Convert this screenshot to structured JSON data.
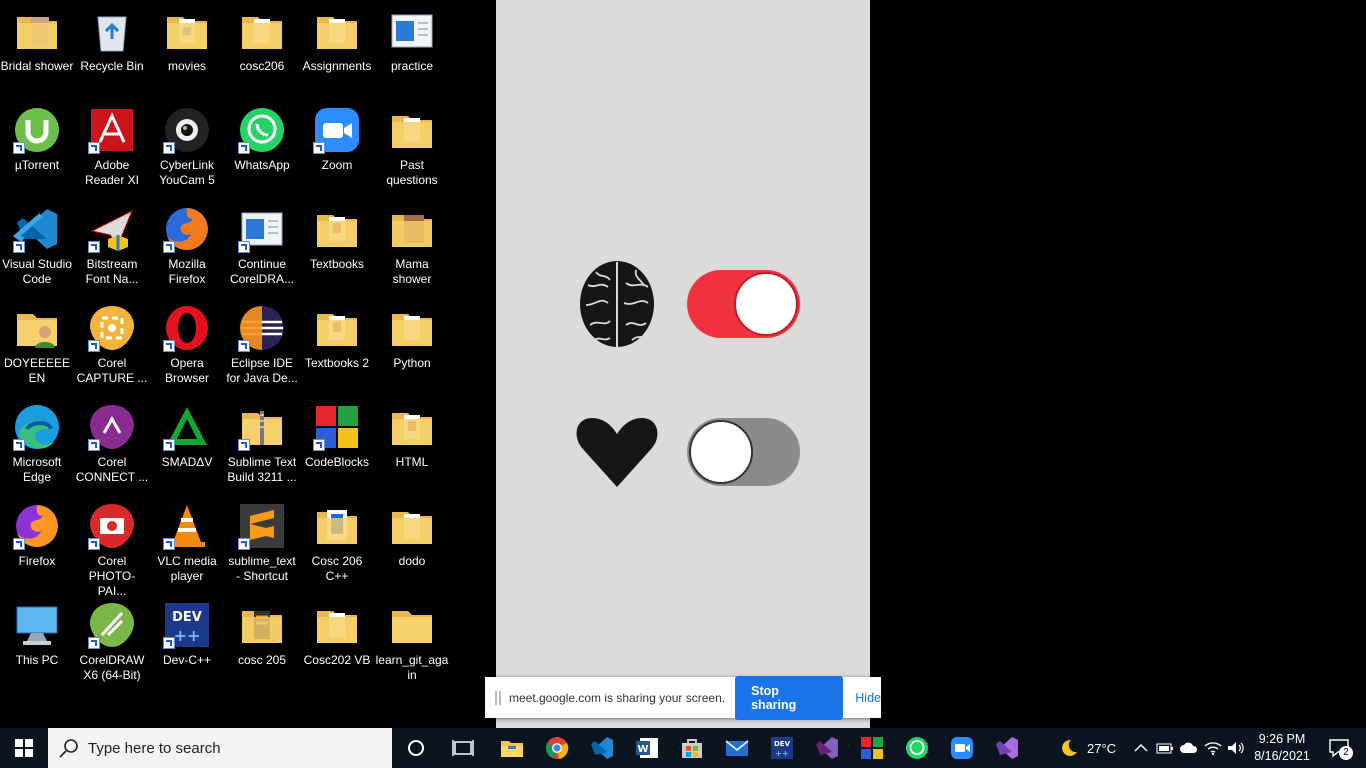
{
  "desktop": {
    "icons": [
      {
        "label": "Bridal shower"
      },
      {
        "label": "Recycle Bin"
      },
      {
        "label": "movies"
      },
      {
        "label": "cosc206"
      },
      {
        "label": "Assignments"
      },
      {
        "label": "practice"
      },
      {
        "label": "µTorrent"
      },
      {
        "label": "Adobe Reader XI"
      },
      {
        "label": "CyberLink YouCam 5"
      },
      {
        "label": "WhatsApp"
      },
      {
        "label": "Zoom"
      },
      {
        "label": "Past questions"
      },
      {
        "label": "Visual Studio Code"
      },
      {
        "label": "Bitstream Font Na..."
      },
      {
        "label": "Mozilla Firefox"
      },
      {
        "label": "Continue CorelDRA..."
      },
      {
        "label": "Textbooks"
      },
      {
        "label": "Mama shower"
      },
      {
        "label": "DOYEEEEEEN"
      },
      {
        "label": "Corel CAPTURE ..."
      },
      {
        "label": "Opera Browser"
      },
      {
        "label": "Eclipse IDE for Java De..."
      },
      {
        "label": "Textbooks 2"
      },
      {
        "label": "Python"
      },
      {
        "label": "Microsoft Edge"
      },
      {
        "label": "Corel CONNECT ..."
      },
      {
        "label": "SMADΔV"
      },
      {
        "label": "Sublime Text Build 3211 ..."
      },
      {
        "label": "CodeBlocks"
      },
      {
        "label": "HTML"
      },
      {
        "label": "Firefox"
      },
      {
        "label": "Corel PHOTO-PAI..."
      },
      {
        "label": "VLC media player"
      },
      {
        "label": "sublime_text - Shortcut"
      },
      {
        "label": "Cosc 206 C++"
      },
      {
        "label": "dodo"
      },
      {
        "label": "This PC"
      },
      {
        "label": "CorelDRAW X6 (64-Bit)"
      },
      {
        "label": "Dev-C++"
      },
      {
        "label": "cosc 205"
      },
      {
        "label": "Cosc202 VB"
      },
      {
        "label": "learn_git_again"
      }
    ]
  },
  "share_bar": {
    "message": "meet.google.com is sharing your screen.",
    "stop_label": "Stop sharing",
    "hide_label": "Hide"
  },
  "taskbar": {
    "search_placeholder": "Type here to search",
    "weather": "27°C",
    "time": "9:26 PM",
    "date": "8/16/2021",
    "notifications": "2"
  },
  "colors": {
    "taskbar": "#0c1420",
    "wallpaper": "#dddada",
    "toggle_on": "#f0323f",
    "accent": "#1a73e8"
  }
}
